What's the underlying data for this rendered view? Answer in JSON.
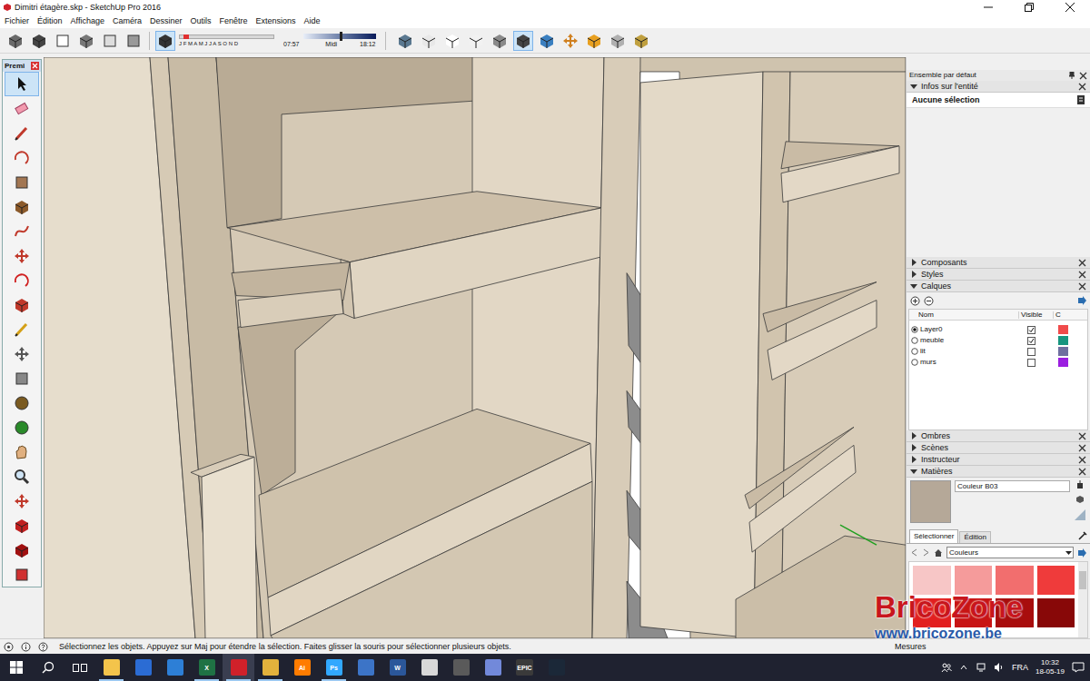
{
  "window": {
    "title": "Dimitri étagère.skp - SketchUp Pro 2016"
  },
  "menu": [
    "Fichier",
    "Édition",
    "Affichage",
    "Caméra",
    "Dessiner",
    "Outils",
    "Fenêtre",
    "Extensions",
    "Aide"
  ],
  "toolbar": {
    "buttons_left": [
      {
        "selected": false
      },
      {
        "selected": false
      },
      {
        "selected": false
      },
      {
        "selected": false
      },
      {
        "selected": false
      },
      {
        "selected": false
      }
    ],
    "shadow_toggle": {
      "selected": true
    },
    "months": "J F M A M J J A S O N D",
    "month_level": 0.04,
    "time_start": "07:57",
    "time_mid": "Midi",
    "time_end": "18:12",
    "time_level": 0.5,
    "buttons_right": [
      {
        "selected": false
      },
      {
        "selected": false
      },
      {
        "selected": false
      },
      {
        "selected": false
      },
      {
        "selected": false
      },
      {
        "selected": true
      },
      {
        "selected": false
      },
      {
        "selected": false
      },
      {
        "selected": false
      },
      {
        "selected": false
      },
      {
        "selected": false
      }
    ]
  },
  "tool_palette": {
    "title": "Premi",
    "tools": [
      {
        "selected": true
      },
      {
        "selected": false
      },
      {
        "selected": false
      },
      {
        "selected": false
      },
      {
        "selected": false
      },
      {
        "selected": false
      },
      {
        "selected": false
      },
      {
        "selected": false
      },
      {
        "selected": false
      },
      {
        "selected": false
      },
      {
        "selected": false
      },
      {
        "selected": false
      },
      {
        "selected": false
      },
      {
        "selected": false
      },
      {
        "selected": false
      },
      {
        "selected": false
      },
      {
        "selected": false
      },
      {
        "selected": false
      },
      {
        "selected": false
      },
      {
        "selected": false
      },
      {
        "selected": false
      }
    ]
  },
  "panel": {
    "title": "Ensemble par défaut",
    "sections": [
      {
        "label": "Infos sur l'entité",
        "expanded": true,
        "kind": "info",
        "text": "Aucune sélection"
      },
      {
        "label": "Composants",
        "expanded": false,
        "kind": "plain"
      },
      {
        "label": "Styles",
        "expanded": false,
        "kind": "plain"
      },
      {
        "label": "Calques",
        "expanded": true,
        "kind": "layers"
      },
      {
        "label": "Ombres",
        "expanded": false,
        "kind": "plain"
      },
      {
        "label": "Scènes",
        "expanded": false,
        "kind": "plain"
      },
      {
        "label": "Instructeur",
        "expanded": false,
        "kind": "plain"
      },
      {
        "label": "Matières",
        "expanded": true,
        "kind": "materials"
      }
    ]
  },
  "layers": {
    "columns": [
      "Nom",
      "Visible",
      "C"
    ],
    "rows": [
      {
        "name": "Layer0",
        "selected": true,
        "visible": true,
        "color": "#f04b4b"
      },
      {
        "name": "meuble",
        "selected": false,
        "visible": true,
        "color": "#17957f"
      },
      {
        "name": "lit",
        "selected": false,
        "visible": false,
        "color": "#6f6f9f"
      },
      {
        "name": "murs",
        "selected": false,
        "visible": false,
        "color": "#9b1ee0"
      }
    ]
  },
  "materials": {
    "name": "Couleur B03",
    "swatch": "#b5a898",
    "tabs": [
      {
        "label": "Sélectionner",
        "selected": true
      },
      {
        "label": "Édition",
        "selected": false
      }
    ],
    "library": "Couleurs",
    "colors": [
      "#f7c6c6",
      "#f59b9b",
      "#f26e6e",
      "#ef3b3b",
      "#e21f1f",
      "#c81414",
      "#a80d0d",
      "#880808"
    ]
  },
  "status_bar": {
    "message": "Sélectionnez les objets. Appuyez sur Maj pour étendre la sélection. Faites glisser la souris pour sélectionner plusieurs objets.",
    "measure_label": "Mesures"
  },
  "taskbar": {
    "apps": [
      {
        "kind": "start",
        "label": "",
        "color": "#ffffff",
        "running": false,
        "selected": false
      },
      {
        "kind": "search",
        "label": "",
        "color": "#ffffff",
        "running": false,
        "selected": false
      },
      {
        "kind": "taskview",
        "label": "",
        "color": "#ffffff",
        "running": false,
        "selected": false
      },
      {
        "kind": "app",
        "label": "",
        "color": "#f3c44b",
        "running": true,
        "selected": false
      },
      {
        "kind": "app",
        "label": "",
        "color": "#2b6cd4",
        "running": false,
        "selected": false
      },
      {
        "kind": "app",
        "label": "",
        "color": "#2d7fd6",
        "running": false,
        "selected": false
      },
      {
        "kind": "app",
        "label": "X",
        "color": "#1f7244",
        "running": true,
        "selected": false
      },
      {
        "kind": "app",
        "label": "",
        "color": "#d0212a",
        "running": true,
        "selected": true
      },
      {
        "kind": "app",
        "label": "",
        "color": "#e3b23c",
        "running": true,
        "selected": false
      },
      {
        "kind": "app",
        "label": "Ai",
        "color": "#ff7c00",
        "running": false,
        "selected": false
      },
      {
        "kind": "app",
        "label": "Ps",
        "color": "#31a8ff",
        "running": true,
        "selected": false
      },
      {
        "kind": "app",
        "label": "",
        "color": "#3c74c7",
        "running": false,
        "selected": false
      },
      {
        "kind": "app",
        "label": "W",
        "color": "#2b579a",
        "running": false,
        "selected": false
      },
      {
        "kind": "app",
        "label": "",
        "color": "#d8d8d8",
        "running": false,
        "selected": false
      },
      {
        "kind": "app",
        "label": "",
        "color": "#5a5a5a",
        "running": false,
        "selected": false
      },
      {
        "kind": "app",
        "label": "",
        "color": "#7289da",
        "running": false,
        "selected": false
      },
      {
        "kind": "app",
        "label": "EPIC",
        "color": "#3a3a3a",
        "running": false,
        "selected": false
      },
      {
        "kind": "app",
        "label": "",
        "color": "#1b2838",
        "running": false,
        "selected": false
      }
    ],
    "language": "FRA",
    "time": "10:32",
    "date": "18-05-19"
  },
  "watermark": {
    "brand": "BricoZone",
    "url": "www.bricozone.be"
  }
}
